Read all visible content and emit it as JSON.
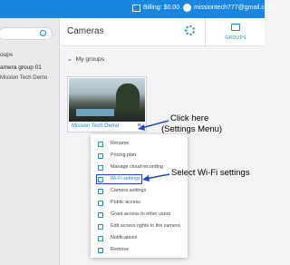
{
  "topbar": {
    "billing": "Billing: $0.00",
    "email": "missiontech777@gmail.com"
  },
  "sidebar": {
    "group_header": "oups",
    "group_item": "amera group 01",
    "group_sub": "Mission Tech Demo"
  },
  "header": {
    "title": "Cameras",
    "groups_tab": "GROUPS"
  },
  "content": {
    "my_groups": "My groups"
  },
  "camera_card": {
    "name": "Mission Tech Demo"
  },
  "menu": {
    "items": [
      {
        "label": "Rename",
        "icon": "edit-icon"
      },
      {
        "label": "Pricing plan",
        "icon": "price-icon"
      },
      {
        "label": "Manage cloud recording",
        "icon": "cloud-icon"
      },
      {
        "label": "Wi-Fi settings",
        "icon": "wifi-icon",
        "selected": true
      },
      {
        "label": "Camera settings",
        "icon": "gear-icon"
      },
      {
        "label": "Public access",
        "icon": "globe-icon"
      },
      {
        "label": "Grant access to other users",
        "icon": "users-icon"
      },
      {
        "label": "Edit access rights to the camera",
        "icon": "lock-icon"
      },
      {
        "label": "Notifications",
        "icon": "bell-icon"
      },
      {
        "label": "Remove",
        "icon": "trash-icon"
      }
    ]
  },
  "annotations": {
    "click_here": "Click here",
    "settings_menu": "(Settings Menu)",
    "select_wifi": "Select Wi-Fi settings"
  },
  "colors": {
    "brand_blue": "#1a86e0",
    "annotation_blue": "#2745c6"
  }
}
